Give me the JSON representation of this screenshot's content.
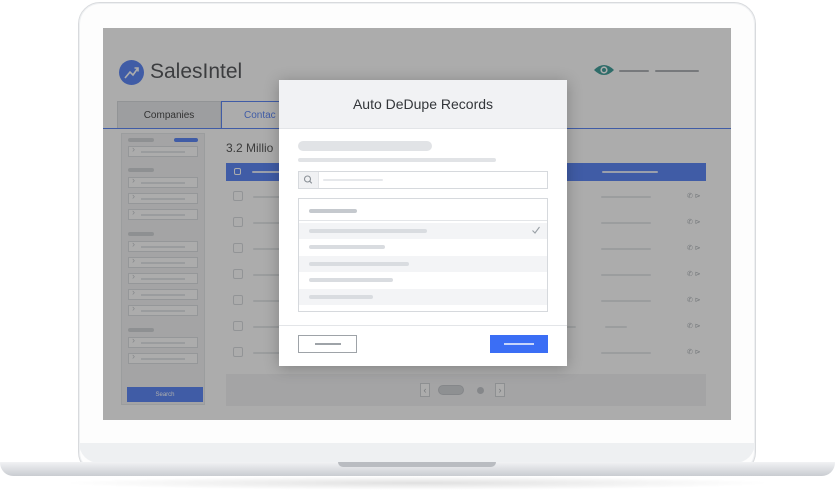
{
  "app": {
    "brand_name": "SalesIntel"
  },
  "tabs": [
    {
      "label": "Companies"
    },
    {
      "label": "Contac"
    }
  ],
  "results": {
    "count_text": "3.2 Millio"
  },
  "sidebar": {
    "search_label": "Search"
  },
  "modal": {
    "title": "Auto DeDupe Records"
  },
  "icons": {
    "logo": "chart-arrow-icon",
    "view": "eye-icon",
    "search": "search-icon",
    "selected": "check-icon",
    "phone": "phone-icon",
    "prev": "chevron-left-icon",
    "next": "chevron-right-icon"
  },
  "colors": {
    "accent": "#3b6ef5",
    "overlay": "#464646",
    "eye": "#1a8a86"
  }
}
